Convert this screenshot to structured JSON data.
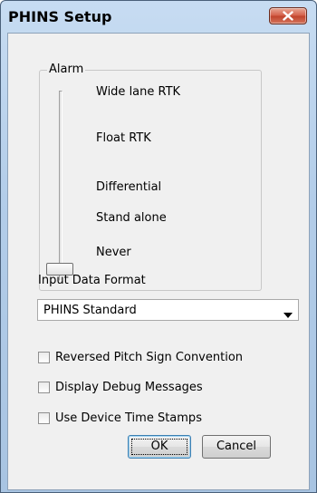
{
  "window": {
    "title": "PHINS Setup",
    "close_icon": "close-x-icon"
  },
  "alarm": {
    "group_label": "Alarm",
    "levels": [
      "Wide lane RTK",
      "Float RTK",
      "Differential",
      "Stand alone",
      "Never"
    ],
    "selected_level": "Never"
  },
  "input_format": {
    "label": "Input Data Format",
    "selected": "PHINS Standard",
    "arrow_icon": "dropdown-arrow-icon"
  },
  "options": [
    {
      "label": "Reversed Pitch Sign Convention",
      "checked": false
    },
    {
      "label": "Display Debug Messages",
      "checked": false
    },
    {
      "label": "Use Device Time Stamps",
      "checked": false
    }
  ],
  "buttons": {
    "ok": "OK",
    "cancel": "Cancel"
  }
}
